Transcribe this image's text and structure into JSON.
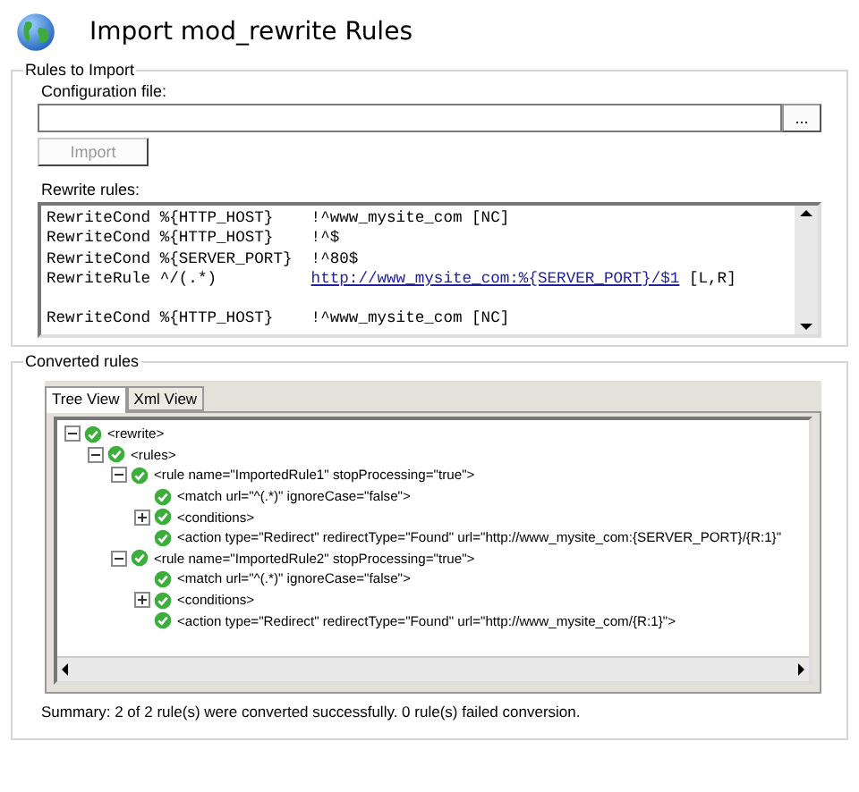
{
  "header": {
    "title": "Import mod_rewrite Rules"
  },
  "rules_to_import": {
    "legend": "Rules to Import",
    "config_label": "Configuration file:",
    "browse_button": "...",
    "import_button": {
      "label": "Import",
      "disabled": true
    },
    "rewrite_label": "Rewrite rules:",
    "lines": [
      {
        "kind": "code",
        "directive": "RewriteCond",
        "variable": "%{HTTP_HOST}",
        "pattern": "!^www_mysite_com",
        "pattern_link": false,
        "flags": "[NC]"
      },
      {
        "kind": "code",
        "directive": "RewriteCond",
        "variable": "%{HTTP_HOST}",
        "pattern": "!^$",
        "pattern_link": false
      },
      {
        "kind": "code",
        "directive": "RewriteCond",
        "variable": "%{SERVER_PORT}",
        "pattern": "!^80$",
        "pattern_link": false
      },
      {
        "kind": "code",
        "directive": "RewriteRule",
        "variable": "^/(.*)",
        "pattern": "http://www_mysite_com:%{SERVER_PORT}/$1",
        "pattern_link": true,
        "flags": "[L,R]"
      },
      {
        "kind": "blank"
      },
      {
        "kind": "code",
        "directive": "RewriteCond",
        "variable": "%{HTTP_HOST}",
        "pattern": "!^www_mysite_com",
        "pattern_link": false,
        "flags": "[NC]"
      }
    ]
  },
  "converted_rules": {
    "legend": "Converted rules",
    "tabs": [
      {
        "label": "Tree View",
        "selected": true
      },
      {
        "label": "Xml View",
        "selected": false
      }
    ],
    "tree": [
      {
        "label": "<rewrite>",
        "expanded": true,
        "children": [
          {
            "label": "<rules>",
            "expanded": true,
            "children": [
              {
                "label": "<rule name=\"ImportedRule1\" stopProcessing=\"true\">",
                "expanded": true,
                "children": [
                  {
                    "label": "<match url=\"^(.*)\" ignoreCase=\"false\">"
                  },
                  {
                    "label": "<conditions>",
                    "expanded": false
                  },
                  {
                    "label": "<action type=\"Redirect\" redirectType=\"Found\" url=\"http://www_mysite_com:{SERVER_PORT}/{R:1}\""
                  }
                ]
              },
              {
                "label": "<rule name=\"ImportedRule2\" stopProcessing=\"true\">",
                "expanded": true,
                "children": [
                  {
                    "label": "<match url=\"^(.*)\" ignoreCase=\"false\">"
                  },
                  {
                    "label": "<conditions>",
                    "expanded": false
                  },
                  {
                    "label": "<action type=\"Redirect\" redirectType=\"Found\" url=\"http://www_mysite_com/{R:1}\">"
                  }
                ]
              }
            ]
          }
        ]
      }
    ],
    "summary": "Summary: 2 of 2 rule(s) were converted successfully. 0 rule(s) failed conversion."
  }
}
